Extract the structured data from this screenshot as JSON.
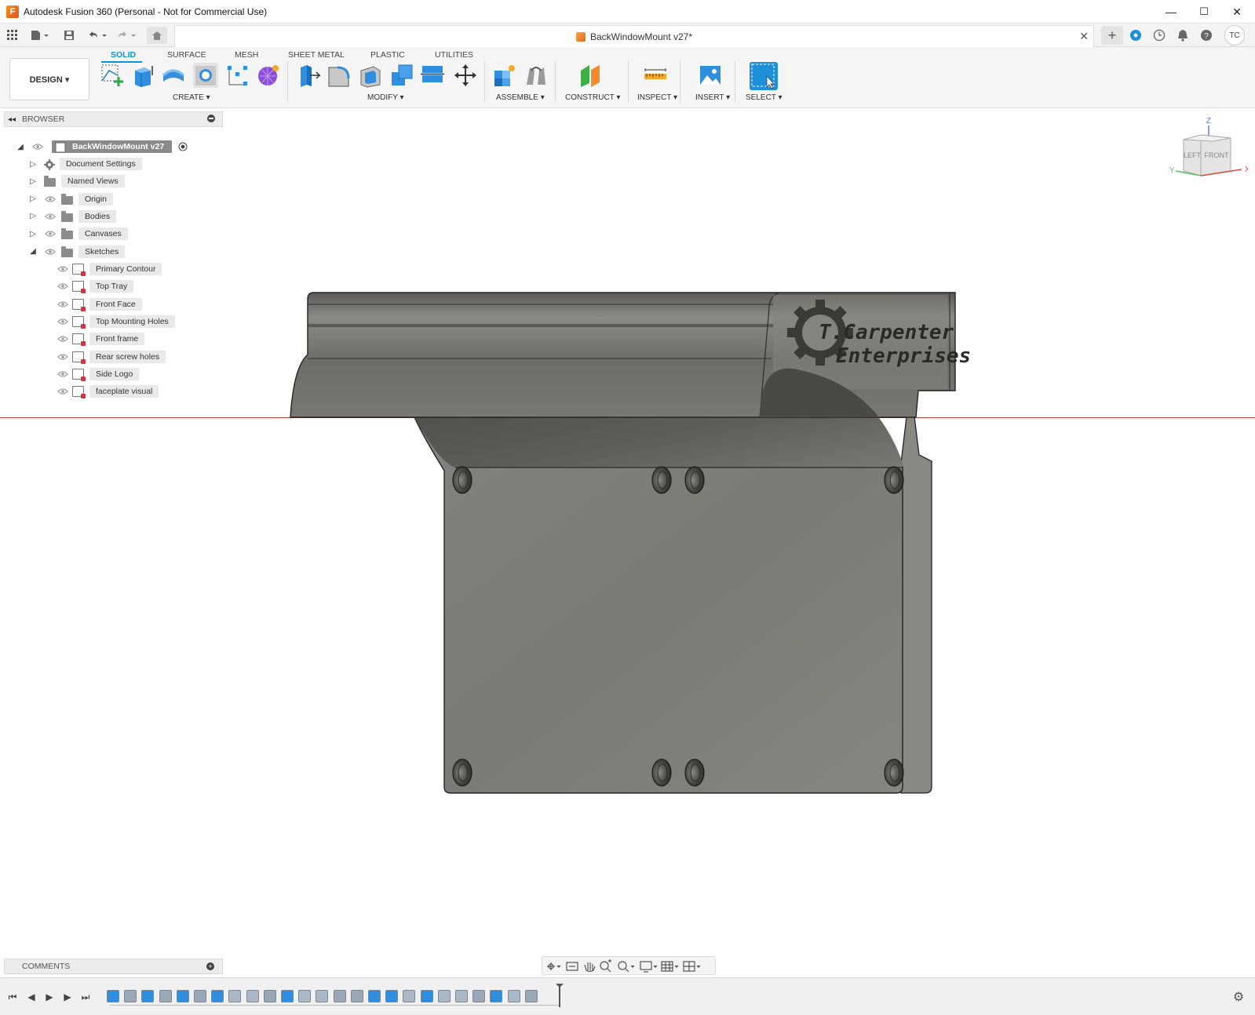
{
  "window": {
    "title": "Autodesk Fusion 360 (Personal - Not for Commercial Use)",
    "minimize": "—",
    "maximize": "☐",
    "close": "✕"
  },
  "document": {
    "tab_name": "BackWindowMount v27*",
    "close": "✕"
  },
  "account": {
    "initials": "TC"
  },
  "ribbon": {
    "workspace": "DESIGN ▾",
    "tabs": [
      "SOLID",
      "SURFACE",
      "MESH",
      "SHEET METAL",
      "PLASTIC",
      "UTILITIES"
    ],
    "groups": {
      "create": "CREATE ▾",
      "modify": "MODIFY ▾",
      "assemble": "ASSEMBLE ▾",
      "construct": "CONSTRUCT ▾",
      "inspect": "INSPECT ▾",
      "insert": "INSERT ▾",
      "select": "SELECT ▾"
    }
  },
  "browser": {
    "header": "BROWSER",
    "root": "BackWindowMount v27",
    "items": [
      "Document Settings",
      "Named Views",
      "Origin",
      "Bodies",
      "Canvases",
      "Sketches"
    ],
    "sketches": [
      "Primary Contour",
      "Top Tray",
      "Front Face",
      "Top Mounting Holes",
      "Front frame",
      "Rear screw holes",
      "Side Logo",
      "faceplate visual"
    ]
  },
  "viewcube": {
    "z": "Z",
    "left": "LEFT",
    "front": "FRONT",
    "x": "X",
    "y": "Y"
  },
  "logo": {
    "line1": "T.Carpenter",
    "line2": "Enterprises"
  },
  "comments": {
    "label": "COMMENTS"
  },
  "colors": {
    "accent": "#0696d7",
    "model": "#7e7c77",
    "axis_red": "#c4403f"
  }
}
